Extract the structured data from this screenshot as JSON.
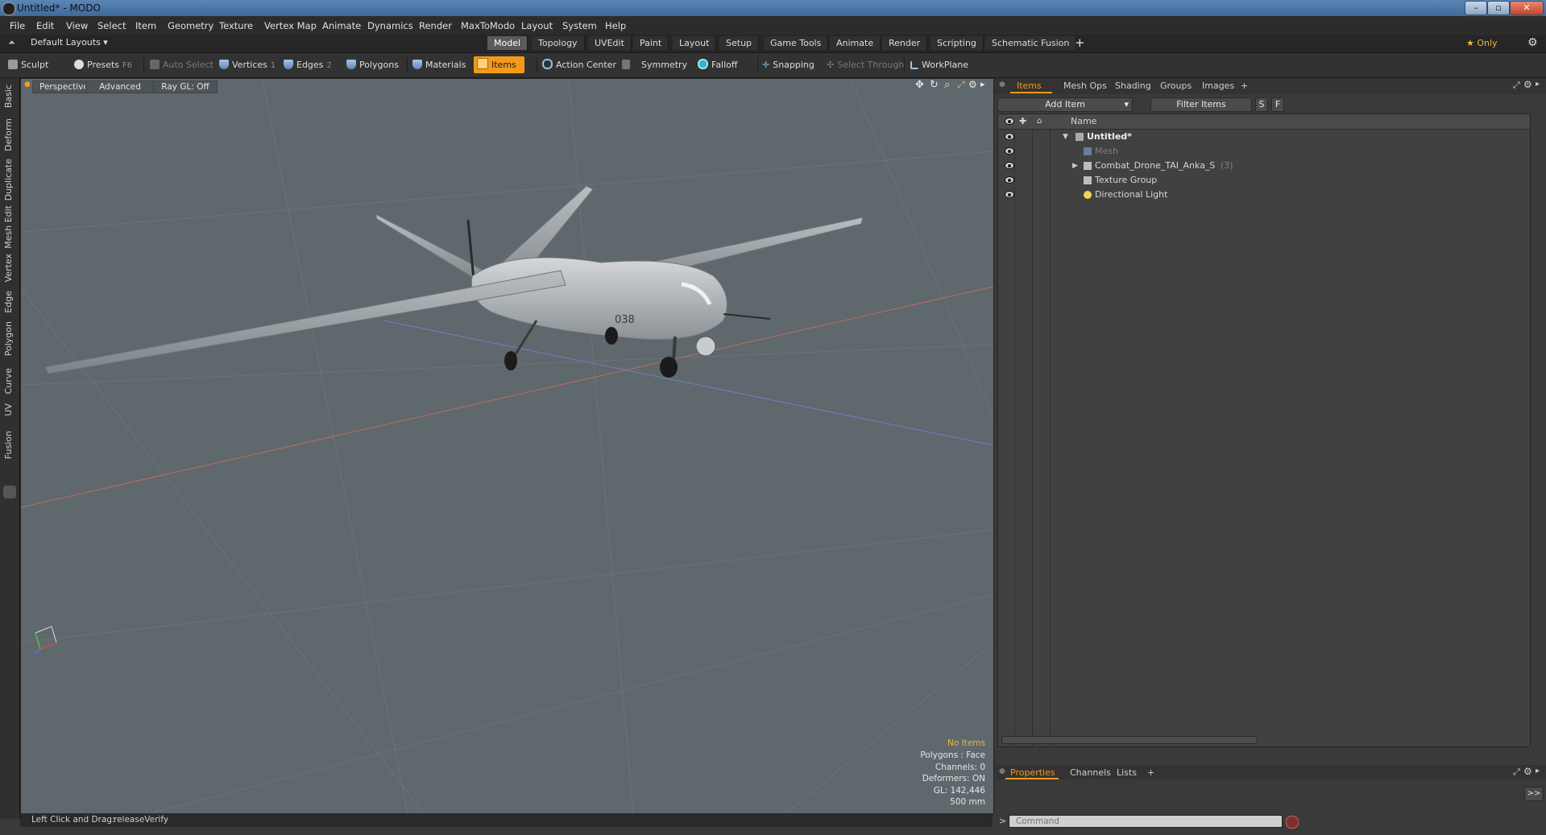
{
  "window": {
    "title": "Untitled* - MODO",
    "minimize": "–",
    "maximize": "▫",
    "close": "✕"
  },
  "menu": [
    "File",
    "Edit",
    "View",
    "Select",
    "Item",
    "Geometry",
    "Texture",
    "Vertex Map",
    "Animate",
    "Dynamics",
    "Render",
    "MaxToModo",
    "Layout",
    "System",
    "Help"
  ],
  "layout_row": {
    "preset": "Default Layouts ▾",
    "tabs": [
      "Model",
      "Topology",
      "UVEdit",
      "Paint",
      "Layout",
      "Setup",
      "Game Tools",
      "Animate",
      "Render",
      "Scripting",
      "Schematic Fusion"
    ],
    "active_tab": "Model",
    "add": "+",
    "only": "★  Only",
    "gear": "⚙"
  },
  "tools": {
    "sculpt": "Sculpt",
    "presets": "Presets",
    "presets_key": "F6",
    "auto_select": "Auto Select",
    "vertices": "Vertices",
    "vertices_key": "1",
    "edges": "Edges",
    "edges_key": "2",
    "polygons": "Polygons",
    "materials": "Materials",
    "items": "Items",
    "action_center": "Action Center",
    "symmetry": "Symmetry",
    "falloff": "Falloff",
    "snapping": "Snapping",
    "select_through": "Select Through",
    "workplane": "WorkPlane"
  },
  "left_tabs": [
    "Basic",
    "Deform",
    "Duplicate",
    "Mesh Edit",
    "Vertex",
    "Edge",
    "Polygon",
    "Curve",
    "UV",
    "Fusion"
  ],
  "viewport": {
    "view": "Perspective",
    "mode": "Advanced",
    "raygl": "Ray GL: Off",
    "hud": {
      "selection": "No Items",
      "polygons": "Polygons : Face",
      "channels": "Channels: 0",
      "deformers": "Deformers: ON",
      "gl": "GL: 142,446",
      "scale": "500 mm"
    },
    "decal": "038"
  },
  "status": {
    "hint": "Left Click and Drag:",
    "action": "releaseVerify"
  },
  "right_panel": {
    "tabs": [
      "Items",
      "Mesh Ops",
      "Shading",
      "Groups",
      "Images"
    ],
    "active_tab": "Items",
    "add_tab": "+",
    "add_item": "Add Item",
    "filter": "Filter Items",
    "s_btn": "S",
    "f_btn": "F",
    "column_name": "Name",
    "tree": [
      {
        "label": "Untitled*",
        "depth": 0,
        "expander": "▼",
        "bold": true
      },
      {
        "label": "Mesh",
        "depth": 1,
        "expander": "",
        "dim": true
      },
      {
        "label": "Combat_Drone_TAI_Anka_S",
        "count": "(3)",
        "depth": 1,
        "expander": "▶"
      },
      {
        "label": "Texture Group",
        "depth": 1,
        "expander": ""
      },
      {
        "label": "Directional Light",
        "depth": 1,
        "expander": ""
      }
    ],
    "bottom_tabs": [
      "Properties",
      "Channels",
      "Lists"
    ],
    "bottom_active": "Properties",
    "bottom_add": "+",
    "expand": ">>",
    "command_prompt": ">",
    "command_placeholder": "Command"
  }
}
